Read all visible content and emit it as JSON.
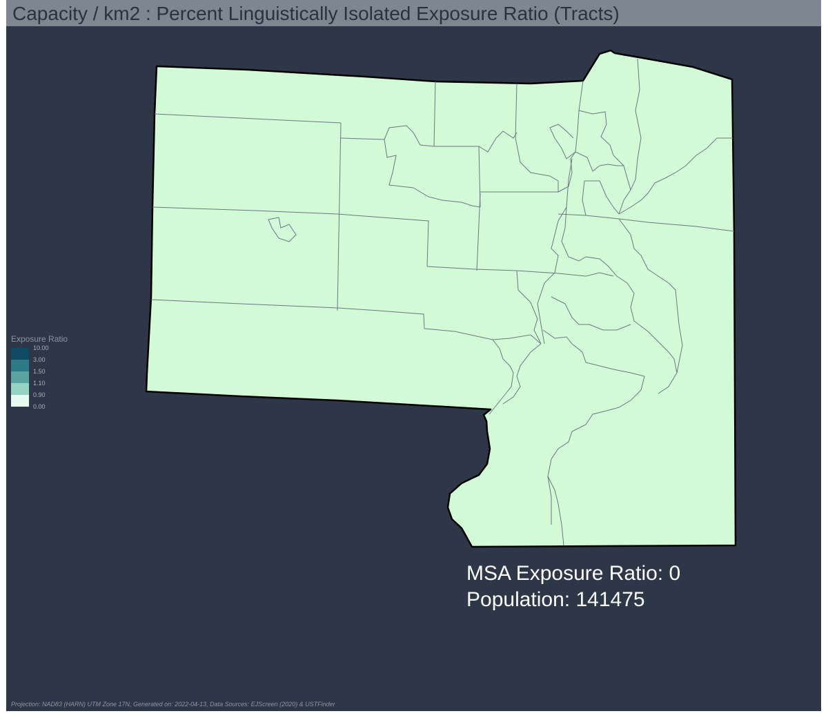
{
  "map": {
    "title": "Capacity / km2 : Percent Linguistically Isolated Exposure Ratio (Tracts)",
    "fill_color": "#d3fad6",
    "background_color": "#2e3747",
    "title_bar_color": "#7e8791"
  },
  "legend": {
    "title": "Exposure Ratio",
    "breaks": [
      "10.00",
      "3.00",
      "1.50",
      "1.10",
      "0.90",
      "0.00"
    ],
    "swatches": [
      {
        "color": "#0e4b63"
      },
      {
        "color": "#2c7a86"
      },
      {
        "color": "#5ba39f"
      },
      {
        "color": "#98d4c2"
      },
      {
        "color": "#e8fbf0"
      }
    ]
  },
  "stats": {
    "exposure_ratio_line": "MSA Exposure Ratio: 0",
    "population_line": "Population: 141475"
  },
  "footer": {
    "text": "Projection: NAD83 (HARN) UTM Zone 17N, Generated on: 2022-04-13, Data Sources: EJScreen (2020) & USTFinder"
  }
}
